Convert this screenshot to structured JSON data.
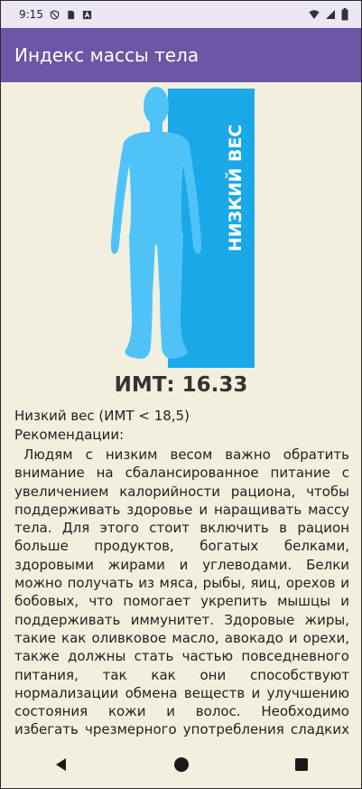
{
  "status_bar": {
    "time": "9:15",
    "left_icons": [
      "shield-icon",
      "sim-icon",
      "text-icon"
    ],
    "right_icons": [
      "wifi-icon",
      "signal-icon",
      "battery-icon"
    ]
  },
  "app_bar": {
    "title": "Индекс массы тела"
  },
  "illustration": {
    "label": "НИЗКИЙ ВЕС",
    "figure_color": "#4FC3F7",
    "panel_color": "#1BA8E8"
  },
  "result": {
    "bmi_text": "ИМТ: 16.33",
    "category": "Низкий вес (ИМТ < 18,5)",
    "recommendations_label": " Рекомендации:",
    "recommendations_text": "Людям с низким весом важно обратить внимание на сбалансированное питание с увеличением калорийности рациона, чтобы поддерживать здоровье и наращивать массу тела. Для этого стоит включить в рацион больше продуктов, богатых белками, здоровыми жирами и углеводами. Белки можно получать из мяса, рыбы, яиц, орехов и бобовых, что помогает укрепить мышцы и поддерживать иммунитет. Здоровые жиры, такие как оливковое масло, авокадо и орехи, также должны стать частью повседневного питания, так как они способствуют нормализации обмена веществ и улучшению состояния кожи и волос. Необходимо избегать чрезмерного употребления сладких и жирных продуктов с низкой питательной"
  },
  "nav_bar": {
    "buttons": [
      "back-icon",
      "home-icon",
      "recents-icon"
    ]
  },
  "colors": {
    "app_bar": "#6C57A6",
    "background": "#F2EFDF",
    "status_bar": "#ECE7F3"
  }
}
